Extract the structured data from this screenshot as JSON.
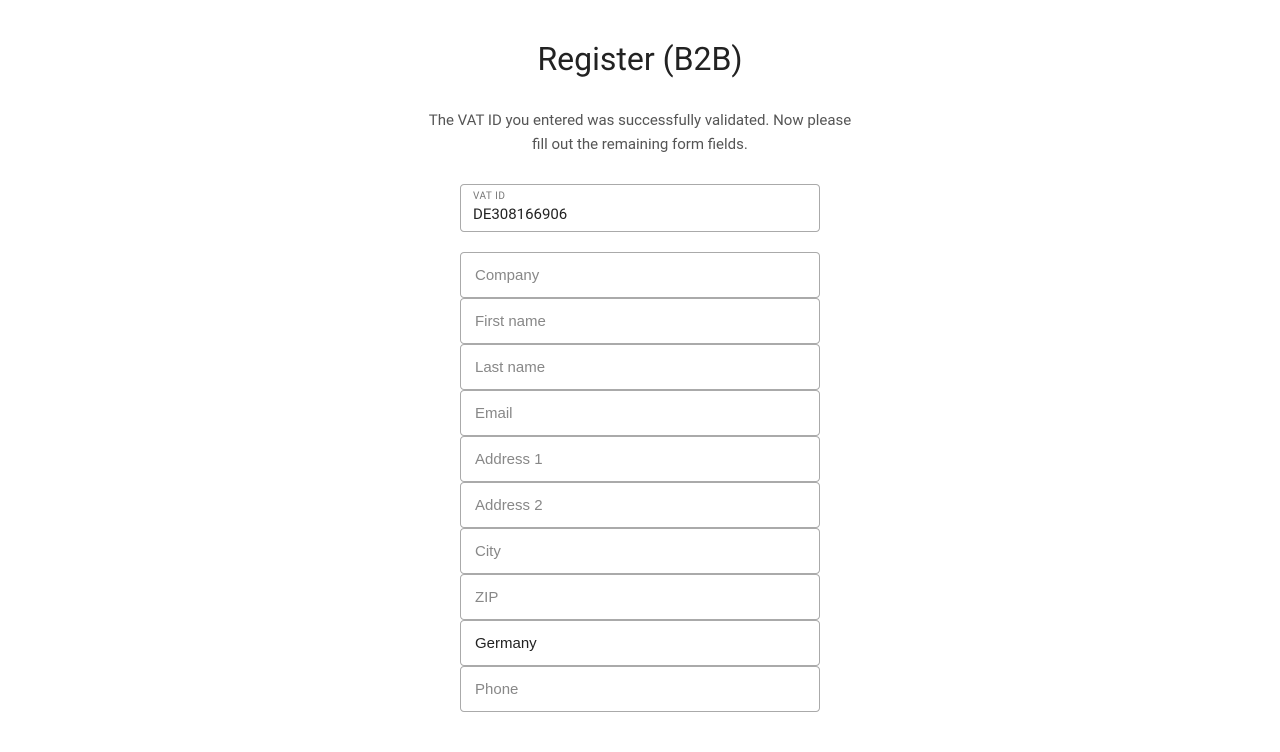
{
  "page": {
    "title": "Register (B2B)",
    "subtitle_line1": "The VAT ID you entered was successfully validated. Now please",
    "subtitle_line2": "fill out the remaining form fields."
  },
  "vat_field": {
    "label": "VAT ID",
    "value": "DE308166906"
  },
  "form": {
    "fields": [
      {
        "name": "company",
        "placeholder": "Company",
        "value": ""
      },
      {
        "name": "first-name",
        "placeholder": "First name",
        "value": ""
      },
      {
        "name": "last-name",
        "placeholder": "Last name",
        "value": ""
      },
      {
        "name": "email",
        "placeholder": "Email",
        "value": ""
      },
      {
        "name": "address1",
        "placeholder": "Address 1",
        "value": ""
      },
      {
        "name": "address2",
        "placeholder": "Address 2",
        "value": ""
      },
      {
        "name": "city",
        "placeholder": "City",
        "value": ""
      },
      {
        "name": "zip",
        "placeholder": "ZIP",
        "value": ""
      },
      {
        "name": "country",
        "placeholder": "Germany",
        "value": "Germany"
      },
      {
        "name": "phone",
        "placeholder": "Phone",
        "value": ""
      }
    ]
  }
}
